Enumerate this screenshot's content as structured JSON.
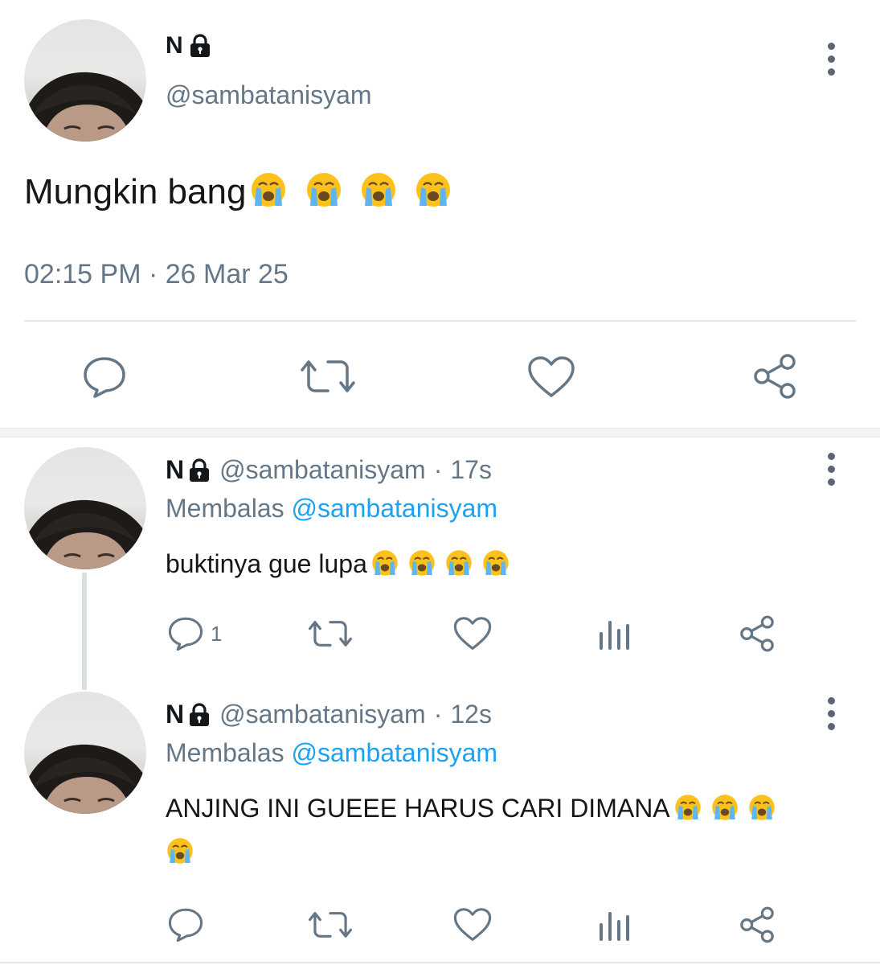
{
  "main_tweet": {
    "name": "N",
    "handle": "@sambatanisyam",
    "text": "Mungkin bang",
    "timestamp": "02:15 PM · 26 Mar 25",
    "icons": [
      "lock-icon",
      "more-icon",
      "reply-icon",
      "retweet-icon",
      "like-icon",
      "share-icon"
    ]
  },
  "replies": [
    {
      "name": "N",
      "handle": "@sambatanisyam",
      "time_sep": "·",
      "time": "17s",
      "replying_label": "Membalas",
      "replying_to": "@sambatanisyam",
      "text": "buktinya gue lupa",
      "reply_count": "1"
    },
    {
      "name": "N",
      "handle": "@sambatanisyam",
      "time_sep": "·",
      "time": "12s",
      "replying_label": "Membalas",
      "replying_to": "@sambatanisyam",
      "text": "ANJING INI GUEEE HARUS CARI DIMANA",
      "reply_count": ""
    }
  ],
  "colors": {
    "text": "#14171a",
    "secondary": "#657786",
    "accent": "#1da1f2",
    "divider": "#e1e8ed"
  }
}
